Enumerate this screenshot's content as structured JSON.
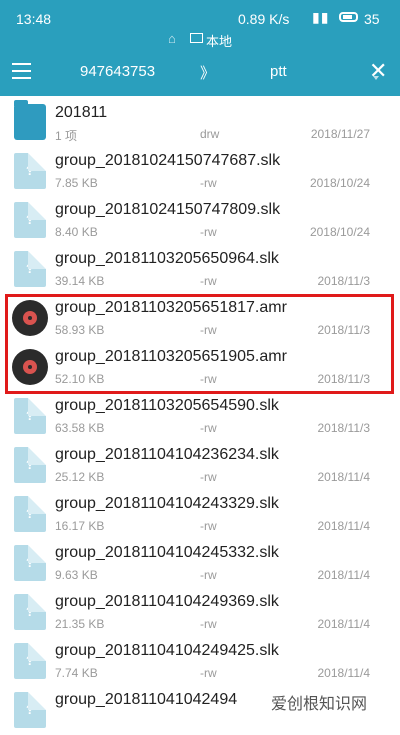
{
  "status": {
    "time": "13:48",
    "network_speed": "0.89 K/s",
    "battery": "35"
  },
  "location": {
    "label": "本地"
  },
  "toolbar": {
    "crumb1": "947643753",
    "separator": "》",
    "crumb2": "ptt"
  },
  "highlight_color": "#e01a1a",
  "accent_color": "#2a9fbd",
  "files": [
    {
      "name": "201811",
      "size": "1 项",
      "perm": "drw",
      "date": "2018/11/27",
      "icon": "folder-icon"
    },
    {
      "name": "group_20181024150747687.slk",
      "size": "7.85 KB",
      "perm": "-rw",
      "date": "2018/10/24",
      "icon": "unknown-file-icon"
    },
    {
      "name": "group_20181024150747809.slk",
      "size": "8.40 KB",
      "perm": "-rw",
      "date": "2018/10/24",
      "icon": "unknown-file-icon"
    },
    {
      "name": "group_20181103205650964.slk",
      "size": "39.14 KB",
      "perm": "-rw",
      "date": "2018/11/3",
      "icon": "unknown-file-icon"
    },
    {
      "name": "group_20181103205651817.amr",
      "size": "58.93 KB",
      "perm": "-rw",
      "date": "2018/11/3",
      "icon": "audio-disc-icon"
    },
    {
      "name": "group_20181103205651905.amr",
      "size": "52.10 KB",
      "perm": "-rw",
      "date": "2018/11/3",
      "icon": "audio-disc-icon"
    },
    {
      "name": "group_20181103205654590.slk",
      "size": "63.58 KB",
      "perm": "-rw",
      "date": "2018/11/3",
      "icon": "unknown-file-icon"
    },
    {
      "name": "group_20181104104236234.slk",
      "size": "25.12 KB",
      "perm": "-rw",
      "date": "2018/11/4",
      "icon": "unknown-file-icon"
    },
    {
      "name": "group_20181104104243329.slk",
      "size": "16.17 KB",
      "perm": "-rw",
      "date": "2018/11/4",
      "icon": "unknown-file-icon"
    },
    {
      "name": "group_20181104104245332.slk",
      "size": "9.63 KB",
      "perm": "-rw",
      "date": "2018/11/4",
      "icon": "unknown-file-icon"
    },
    {
      "name": "group_20181104104249369.slk",
      "size": "21.35 KB",
      "perm": "-rw",
      "date": "2018/11/4",
      "icon": "unknown-file-icon"
    },
    {
      "name": "group_20181104104249425.slk",
      "size": "7.74 KB",
      "perm": "-rw",
      "date": "2018/11/4",
      "icon": "unknown-file-icon"
    },
    {
      "name": "group_201811041042494",
      "size": "",
      "perm": "",
      "date": "",
      "icon": "unknown-file-icon"
    }
  ],
  "watermark": "爱创根知识网"
}
